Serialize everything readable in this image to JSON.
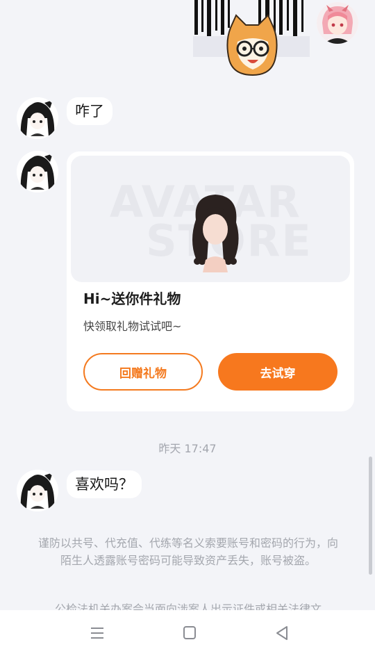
{
  "messages": {
    "m1": "咋了",
    "m2": "喜欢吗？"
  },
  "gift_card": {
    "banner_line1": "AVATAR",
    "banner_line2": "STORE",
    "title": "Hi~送你件礼物",
    "subtitle": "快领取礼物试试吧~",
    "return_gift_label": "回赠礼物",
    "try_on_label": "去试穿"
  },
  "timestamp": "昨天 17:47",
  "notices": {
    "safety": "谨防以共号、代充值、代练等名义索要账号和密码的行为，向陌生人透露账号密码可能导致资产丢失，账号被盗。",
    "police": "公检法机关办案会当面向涉案人出示证件或相关法律文"
  },
  "colors": {
    "accent": "#f7781e",
    "background": "#f3f4f8"
  },
  "icons": {
    "nav_menu": "menu-icon",
    "nav_home": "home-icon",
    "nav_back": "back-icon"
  }
}
